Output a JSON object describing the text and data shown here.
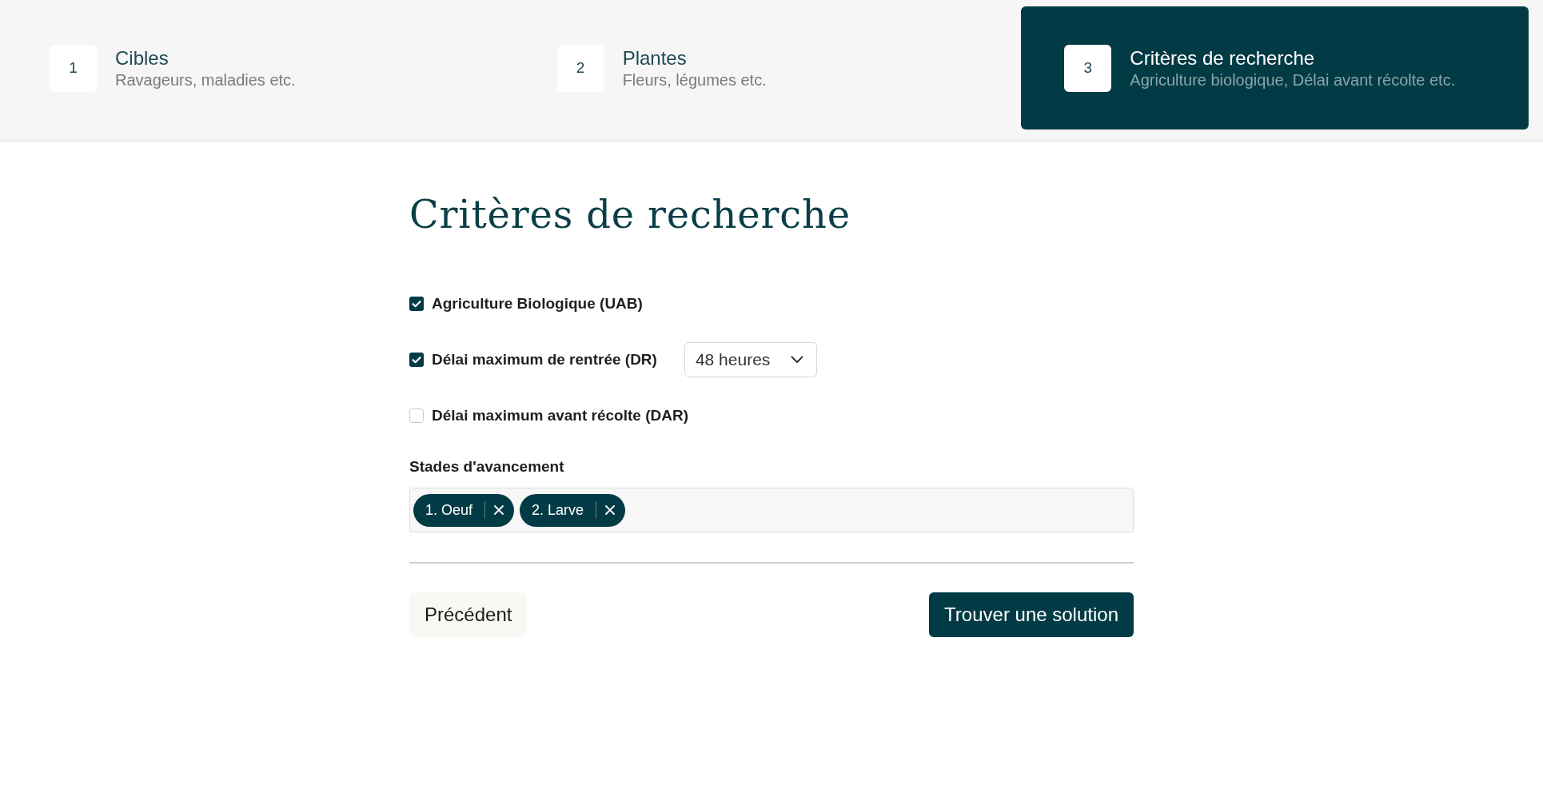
{
  "steps": [
    {
      "number": "1",
      "title": "Cibles",
      "subtitle": "Ravageurs, maladies etc.",
      "selected": false
    },
    {
      "number": "2",
      "title": "Plantes",
      "subtitle": "Fleurs, légumes etc.",
      "selected": false
    },
    {
      "number": "3",
      "title": "Critères de recherche",
      "subtitle": "Agriculture biologique, Délai avant récolte etc.",
      "selected": true
    }
  ],
  "page_title": "Critères de recherche",
  "criteria": [
    {
      "label": "Agriculture Biologique (UAB)",
      "checked": true
    },
    {
      "label": "Délai maximum de rentrée (DR)",
      "checked": true,
      "select": {
        "value": "48 heures"
      }
    },
    {
      "label": "Délai maximum avant récolte (DAR)",
      "checked": false
    }
  ],
  "stages": {
    "label": "Stades d'avancement",
    "chips": [
      "1. Oeuf",
      "2. Larve"
    ]
  },
  "buttons": [
    {
      "label": "Précédent",
      "kind": "secondary"
    },
    {
      "label": "Trouver une solution",
      "kind": "primary"
    }
  ]
}
